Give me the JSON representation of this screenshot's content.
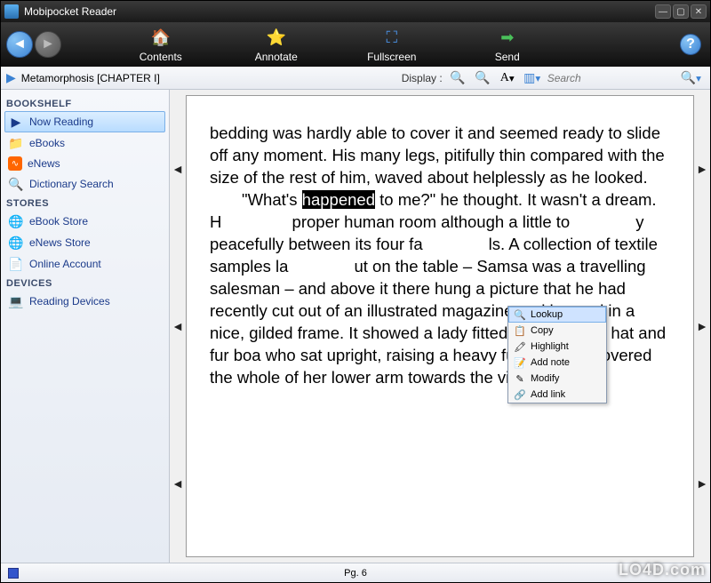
{
  "app": {
    "title": "Mobipocket Reader"
  },
  "toolbar": {
    "contents": "Contents",
    "annotate": "Annotate",
    "fullscreen": "Fullscreen",
    "send": "Send"
  },
  "subbar": {
    "breadcrumb": "Metamorphosis [CHAPTER I]",
    "display_label": "Display :",
    "search_placeholder": "Search"
  },
  "sidebar": {
    "sections": {
      "bookshelf": {
        "header": "BOOKSHELF",
        "items": [
          "Now Reading",
          "eBooks",
          "eNews",
          "Dictionary Search"
        ]
      },
      "stores": {
        "header": "STORES",
        "items": [
          "eBook Store",
          "eNews Store",
          "Online Account"
        ]
      },
      "devices": {
        "header": "DEVICES",
        "items": [
          "Reading Devices"
        ]
      }
    }
  },
  "reader": {
    "text_pre": "bedding was hardly able to cover it and seemed ready to slide off any moment. His many legs, pitifully thin compared with the size of the rest of him, waved about helplessly as he looked.",
    "quote_open": "\"What's ",
    "selected_word": "happened",
    "quote_mid_1": " to me?\" he thought. It wasn't a dream. H",
    "quote_mid_2": " proper human room although a little to",
    "quote_mid_3": "y peacefully between its four fa",
    "quote_mid_4": "ls. A collection of textile samples la",
    "quote_rest": "ut on the table – Samsa was a travelling salesman – and above it there hung a picture that he had recently cut out of an illustrated magazine and housed in a nice, gilded frame. It showed a lady fitted out with a fur hat and fur boa who sat upright, raising a heavy fur muff that covered the whole of her lower arm towards the viewer.",
    "page_label": "Pg. 6"
  },
  "context_menu": {
    "items": [
      "Lookup",
      "Copy",
      "Highlight",
      "Add note",
      "Modify",
      "Add link"
    ]
  },
  "watermark": "LO4D.com"
}
